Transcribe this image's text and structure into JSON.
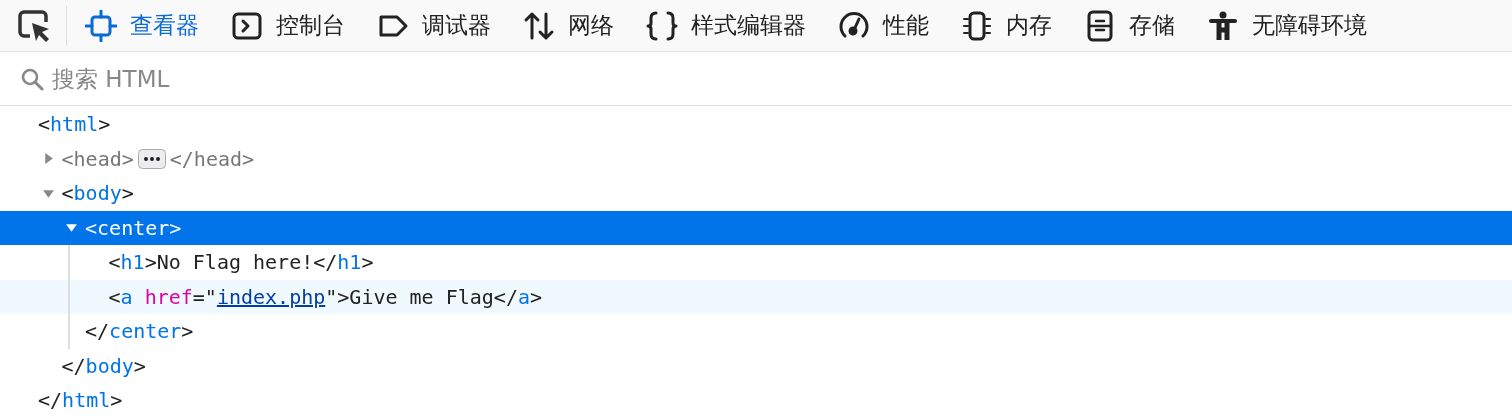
{
  "toolbar": {
    "tabs": [
      {
        "label": "查看器",
        "selected": true
      },
      {
        "label": "控制台",
        "selected": false
      },
      {
        "label": "调试器",
        "selected": false
      },
      {
        "label": "网络",
        "selected": false
      },
      {
        "label": "样式编辑器",
        "selected": false
      },
      {
        "label": "性能",
        "selected": false
      },
      {
        "label": "内存",
        "selected": false
      },
      {
        "label": "存储",
        "selected": false
      },
      {
        "label": "无障碍环境",
        "selected": false
      }
    ]
  },
  "search": {
    "placeholder": "搜索 HTML"
  },
  "tree": [
    {
      "open": [
        {
          "kind": "punct",
          "text": "<"
        },
        {
          "kind": "tag",
          "text": "html"
        },
        {
          "kind": "punct",
          "text": ">"
        }
      ],
      "selected": false,
      "hovered": false,
      "dimmed": false,
      "close": [
        {
          "kind": "punct",
          "text": "</"
        },
        {
          "kind": "tag",
          "text": "html"
        },
        {
          "kind": "punct",
          "text": ">"
        }
      ],
      "children": [
        {
          "open": [
            {
              "kind": "punct",
              "text": "<"
            },
            {
              "kind": "tag",
              "text": "head"
            },
            {
              "kind": "punct",
              "text": ">"
            }
          ],
          "expanded": false,
          "selected": false,
          "hovered": false,
          "dimmed": true,
          "close": [
            {
              "kind": "punct",
              "text": "</"
            },
            {
              "kind": "tag",
              "text": "head"
            },
            {
              "kind": "punct",
              "text": ">"
            }
          ]
        },
        {
          "open": [
            {
              "kind": "punct",
              "text": "<"
            },
            {
              "kind": "tag",
              "text": "body"
            },
            {
              "kind": "punct",
              "text": ">"
            }
          ],
          "expanded": true,
          "selected": false,
          "hovered": false,
          "dimmed": false,
          "close": [
            {
              "kind": "punct",
              "text": "</"
            },
            {
              "kind": "tag",
              "text": "body"
            },
            {
              "kind": "punct",
              "text": ">"
            }
          ],
          "children": [
            {
              "open": [
                {
                  "kind": "punct",
                  "text": "<"
                },
                {
                  "kind": "tag",
                  "text": "center"
                },
                {
                  "kind": "punct",
                  "text": ">"
                }
              ],
              "expanded": true,
              "selected": true,
              "hovered": false,
              "dimmed": false,
              "close": [
                {
                  "kind": "punct",
                  "text": "</"
                },
                {
                  "kind": "tag",
                  "text": "center"
                },
                {
                  "kind": "punct",
                  "text": ">"
                }
              ],
              "children": [
                {
                  "open": [
                    {
                      "kind": "punct",
                      "text": "<"
                    },
                    {
                      "kind": "tag",
                      "text": "h1"
                    },
                    {
                      "kind": "punct",
                      "text": ">"
                    },
                    {
                      "kind": "text",
                      "text": "No Flag here!"
                    },
                    {
                      "kind": "punct",
                      "text": "</"
                    },
                    {
                      "kind": "tag",
                      "text": "h1"
                    },
                    {
                      "kind": "punct",
                      "text": ">"
                    }
                  ],
                  "selected": false,
                  "hovered": false,
                  "dimmed": false
                },
                {
                  "open": [
                    {
                      "kind": "punct",
                      "text": "<"
                    },
                    {
                      "kind": "tag",
                      "text": "a"
                    },
                    {
                      "kind": "attr",
                      "text": "href"
                    },
                    {
                      "kind": "punct",
                      "text": "=\""
                    },
                    {
                      "kind": "link",
                      "text": "index.php"
                    },
                    {
                      "kind": "punct",
                      "text": "\">"
                    },
                    {
                      "kind": "text",
                      "text": "Give me Flag"
                    },
                    {
                      "kind": "punct",
                      "text": "</"
                    },
                    {
                      "kind": "tag",
                      "text": "a"
                    },
                    {
                      "kind": "punct",
                      "text": ">"
                    }
                  ],
                  "selected": false,
                  "hovered": true,
                  "dimmed": false
                }
              ]
            }
          ]
        }
      ]
    }
  ]
}
